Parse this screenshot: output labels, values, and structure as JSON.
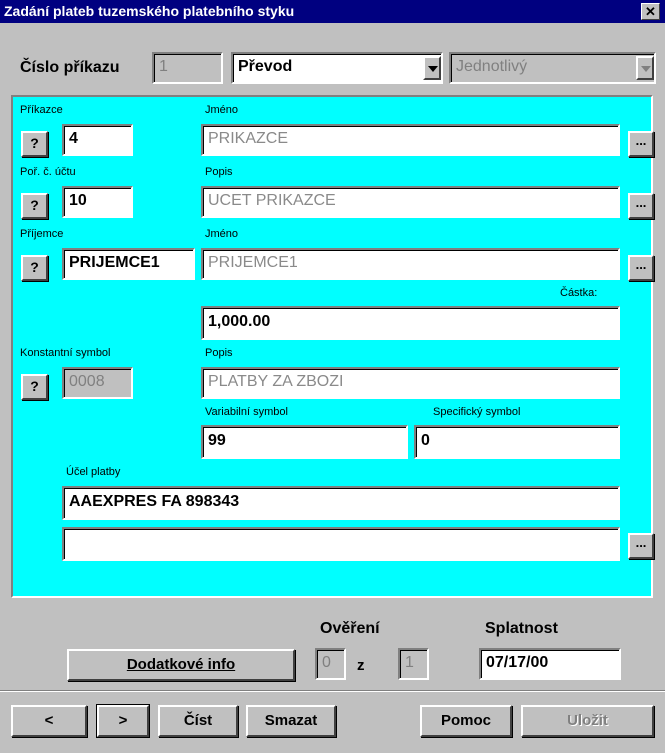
{
  "window": {
    "title": "Zadání plateb tuzemského platebního styku",
    "close_glyph": "✕"
  },
  "header": {
    "cislo_label": "Číslo příkazu",
    "cislo_value": "1",
    "type_value": "Převod",
    "mode_value": "Jednotlivý"
  },
  "prikazce": {
    "label": "Příkazce",
    "value": "4",
    "name_label": "Jméno",
    "name_value": "PRIKAZCE"
  },
  "ucet": {
    "label": "Poř. č. účtu",
    "value": "10",
    "popis_label": "Popis",
    "popis_value": "UCET PRIKAZCE"
  },
  "prijemce": {
    "label": "Příjemce",
    "value": "PRIJEMCE1",
    "name_label": "Jméno",
    "name_value": "PRIJEMCE1"
  },
  "castka": {
    "label": "Částka:",
    "value": "1,000.00"
  },
  "konst": {
    "label": "Konstantní symbol",
    "value": "0008",
    "popis_label": "Popis",
    "popis_value": "PLATBY ZA ZBOZI"
  },
  "var_symbol": {
    "label": "Variabilní symbol",
    "value": "99"
  },
  "spec_symbol": {
    "label": "Specifický symbol",
    "value": "0"
  },
  "ucel": {
    "label": "Účel platby",
    "line1": "AAEXPRES FA 898343",
    "line2": ""
  },
  "buttons": {
    "question": "?",
    "dots": "...",
    "dodatkove": "Dodatkové info",
    "prev": "<",
    "next": ">",
    "cist": "Číst",
    "smazat": "Smazat",
    "pomoc": "Pomoc",
    "ulozit": "Uložit"
  },
  "overeni": {
    "label": "Ověření",
    "value1": "0",
    "z": "z",
    "value2": "1"
  },
  "splatnost": {
    "label": "Splatnost",
    "value": "07/17/00"
  }
}
